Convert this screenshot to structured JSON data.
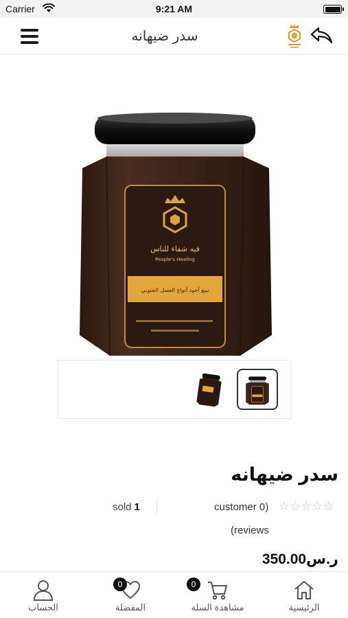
{
  "status_bar": {
    "carrier": "Carrier",
    "time": "9:21 AM"
  },
  "header": {
    "title": "سدر ضيهانه",
    "menu_icon": "hamburger-menu-icon",
    "back_icon": "reply-arrow-icon",
    "logo_icon": "crown-honeycomb-logo"
  },
  "product": {
    "name": "سدر ضيهانه",
    "sold_label": "sold",
    "sold_count": "1",
    "customer_text": "customer 0)",
    "reviews_text": "(reviews",
    "rating": 0,
    "rating_max": 5,
    "price": "ر.س350.00",
    "label_text_1": "فيه شفاء للناس",
    "label_text_2": "People's Healing",
    "label_text_3": "نبيع أجود أنواع العسل الجنوبي"
  },
  "thumbnails": [
    {
      "name": "jar-front",
      "selected": true
    },
    {
      "name": "jar-side",
      "selected": false
    }
  ],
  "tab_bar": {
    "home": "الرئيسية",
    "cart": "مشاهدة السلة",
    "cart_badge": "0",
    "favorites": "المفضلة",
    "favorites_badge": "0",
    "account": "الحساب"
  },
  "colors": {
    "honey_dark": "#3a231a",
    "label_gold": "#e2a63a",
    "lid_black": "#1a1a1a",
    "text_primary": "#111111"
  }
}
